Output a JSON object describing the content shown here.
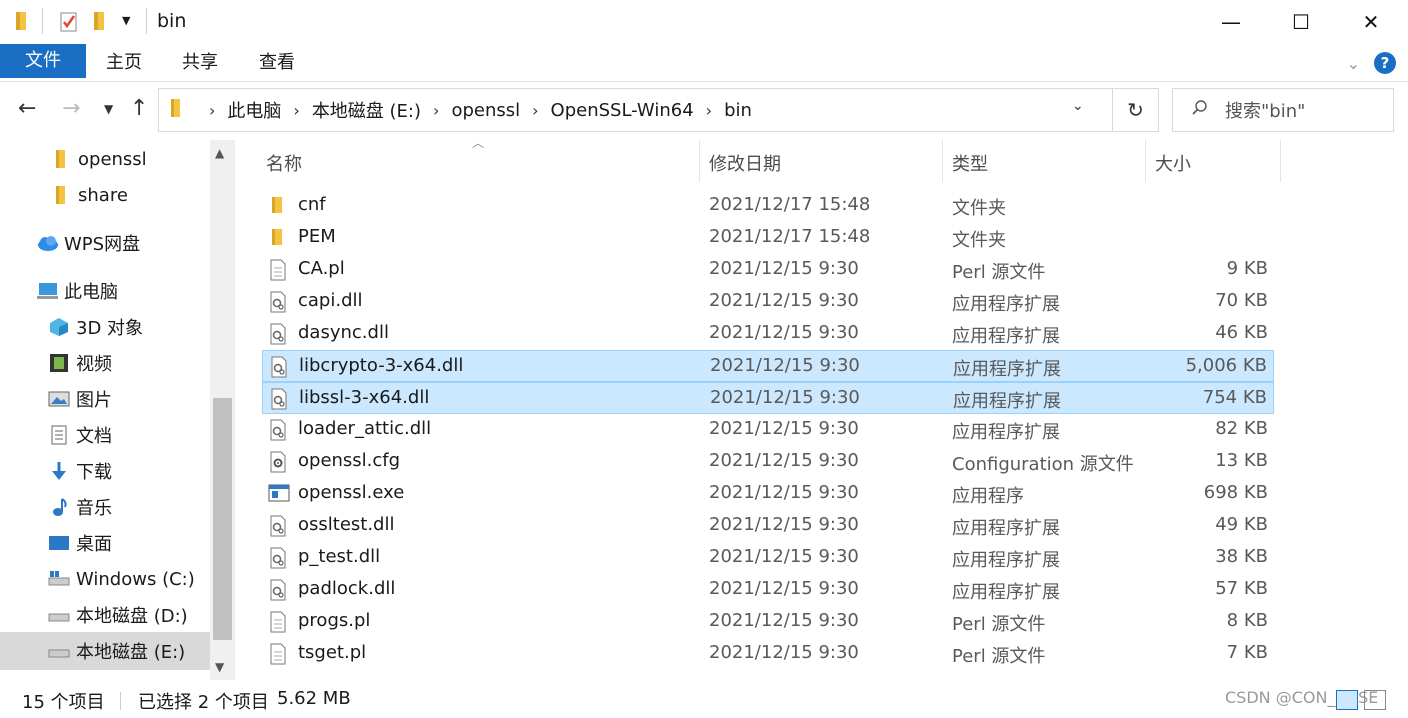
{
  "window": {
    "title": "bin",
    "controls": {
      "minimize": "—",
      "maximize": "☐",
      "close": "✕"
    }
  },
  "ribbon": {
    "tabs": [
      "文件",
      "主页",
      "共享",
      "查看"
    ]
  },
  "address": {
    "crumbs": [
      "此电脑",
      "本地磁盘 (E:)",
      "openssl",
      "OpenSSL-Win64",
      "bin"
    ],
    "search_placeholder": "搜索\"bin\""
  },
  "nav": {
    "items": [
      {
        "label": "openssl",
        "icon": "folder-icon"
      },
      {
        "label": "share",
        "icon": "folder-icon"
      },
      {
        "label": "WPS网盘",
        "icon": "cloud-icon"
      },
      {
        "label": "此电脑",
        "icon": "computer-icon"
      },
      {
        "label": "3D 对象",
        "icon": "cube-icon"
      },
      {
        "label": "视频",
        "icon": "video-icon"
      },
      {
        "label": "图片",
        "icon": "picture-icon"
      },
      {
        "label": "文档",
        "icon": "document-icon"
      },
      {
        "label": "下载",
        "icon": "download-icon"
      },
      {
        "label": "音乐",
        "icon": "music-icon"
      },
      {
        "label": "桌面",
        "icon": "desktop-icon"
      },
      {
        "label": "Windows (C:)",
        "icon": "drive-windows-icon"
      },
      {
        "label": "本地磁盘 (D:)",
        "icon": "drive-icon"
      },
      {
        "label": "本地磁盘 (E:)",
        "icon": "drive-icon"
      }
    ]
  },
  "columns": {
    "name": "名称",
    "date": "修改日期",
    "type": "类型",
    "size": "大小"
  },
  "files": [
    {
      "name": "cnf",
      "date": "2021/12/17 15:48",
      "type": "文件夹",
      "size": "",
      "icon": "folder-icon",
      "selected": false
    },
    {
      "name": "PEM",
      "date": "2021/12/17 15:48",
      "type": "文件夹",
      "size": "",
      "icon": "folder-icon",
      "selected": false
    },
    {
      "name": "CA.pl",
      "date": "2021/12/15 9:30",
      "type": "Perl 源文件",
      "size": "9 KB",
      "icon": "text-file-icon",
      "selected": false
    },
    {
      "name": "capi.dll",
      "date": "2021/12/15 9:30",
      "type": "应用程序扩展",
      "size": "70 KB",
      "icon": "dll-file-icon",
      "selected": false
    },
    {
      "name": "dasync.dll",
      "date": "2021/12/15 9:30",
      "type": "应用程序扩展",
      "size": "46 KB",
      "icon": "dll-file-icon",
      "selected": false
    },
    {
      "name": "libcrypto-3-x64.dll",
      "date": "2021/12/15 9:30",
      "type": "应用程序扩展",
      "size": "5,006 KB",
      "icon": "dll-file-icon",
      "selected": true
    },
    {
      "name": "libssl-3-x64.dll",
      "date": "2021/12/15 9:30",
      "type": "应用程序扩展",
      "size": "754 KB",
      "icon": "dll-file-icon",
      "selected": true
    },
    {
      "name": "loader_attic.dll",
      "date": "2021/12/15 9:30",
      "type": "应用程序扩展",
      "size": "82 KB",
      "icon": "dll-file-icon",
      "selected": false
    },
    {
      "name": "openssl.cfg",
      "date": "2021/12/15 9:30",
      "type": "Configuration 源文件",
      "size": "13 KB",
      "icon": "config-file-icon",
      "selected": false
    },
    {
      "name": "openssl.exe",
      "date": "2021/12/15 9:30",
      "type": "应用程序",
      "size": "698 KB",
      "icon": "exe-file-icon",
      "selected": false
    },
    {
      "name": "ossltest.dll",
      "date": "2021/12/15 9:30",
      "type": "应用程序扩展",
      "size": "49 KB",
      "icon": "dll-file-icon",
      "selected": false
    },
    {
      "name": "p_test.dll",
      "date": "2021/12/15 9:30",
      "type": "应用程序扩展",
      "size": "38 KB",
      "icon": "dll-file-icon",
      "selected": false
    },
    {
      "name": "padlock.dll",
      "date": "2021/12/15 9:30",
      "type": "应用程序扩展",
      "size": "57 KB",
      "icon": "dll-file-icon",
      "selected": false
    },
    {
      "name": "progs.pl",
      "date": "2021/12/15 9:30",
      "type": "Perl 源文件",
      "size": "8 KB",
      "icon": "text-file-icon",
      "selected": false
    },
    {
      "name": "tsget.pl",
      "date": "2021/12/15 9:30",
      "type": "Perl 源文件",
      "size": "7 KB",
      "icon": "text-file-icon",
      "selected": false
    }
  ],
  "status": {
    "count": "15 个项目",
    "selected": "已选择 2 个项目",
    "size": "5.62 MB"
  },
  "watermark": "CSDN @CON_BUSE",
  "colors": {
    "accent": "#1a6fc4",
    "selection_bg": "#cce8ff",
    "selection_border": "#99d1ff",
    "folder": "#f3c43f"
  }
}
